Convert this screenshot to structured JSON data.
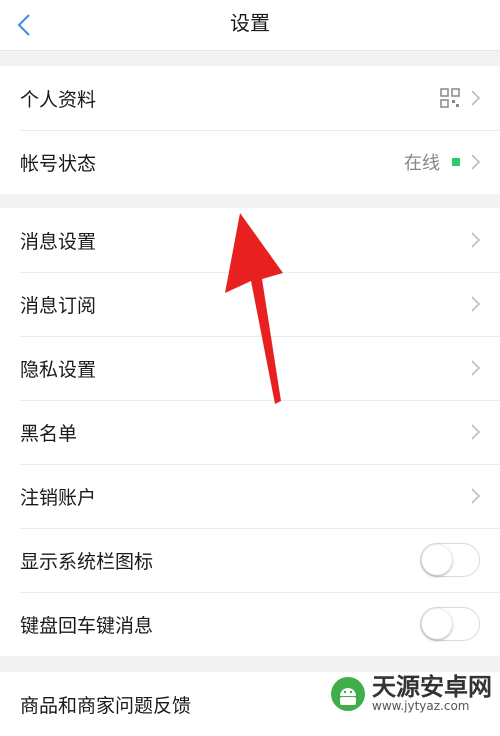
{
  "header": {
    "title": "设置",
    "back_icon": "chevron-left-icon",
    "accent": "#3a8ee6"
  },
  "group1": [
    {
      "label": "个人资料",
      "right_icon": "qr-code-icon"
    },
    {
      "label": "帐号状态",
      "status": "在线",
      "status_color": "#2ecc71"
    }
  ],
  "group2": [
    {
      "label": "消息设置"
    },
    {
      "label": "消息订阅"
    },
    {
      "label": "隐私设置"
    },
    {
      "label": "黑名单"
    },
    {
      "label": "注销账户"
    },
    {
      "label": "显示系统栏图标",
      "toggle": false
    },
    {
      "label": "键盘回车键消息",
      "toggle": false
    }
  ],
  "group3": [
    {
      "label": "商品和商家问题反馈"
    }
  ],
  "annotation": {
    "arrow_color": "#e8201f"
  },
  "watermark": {
    "title": "天源安卓网",
    "url": "www.jytyaz.com"
  }
}
